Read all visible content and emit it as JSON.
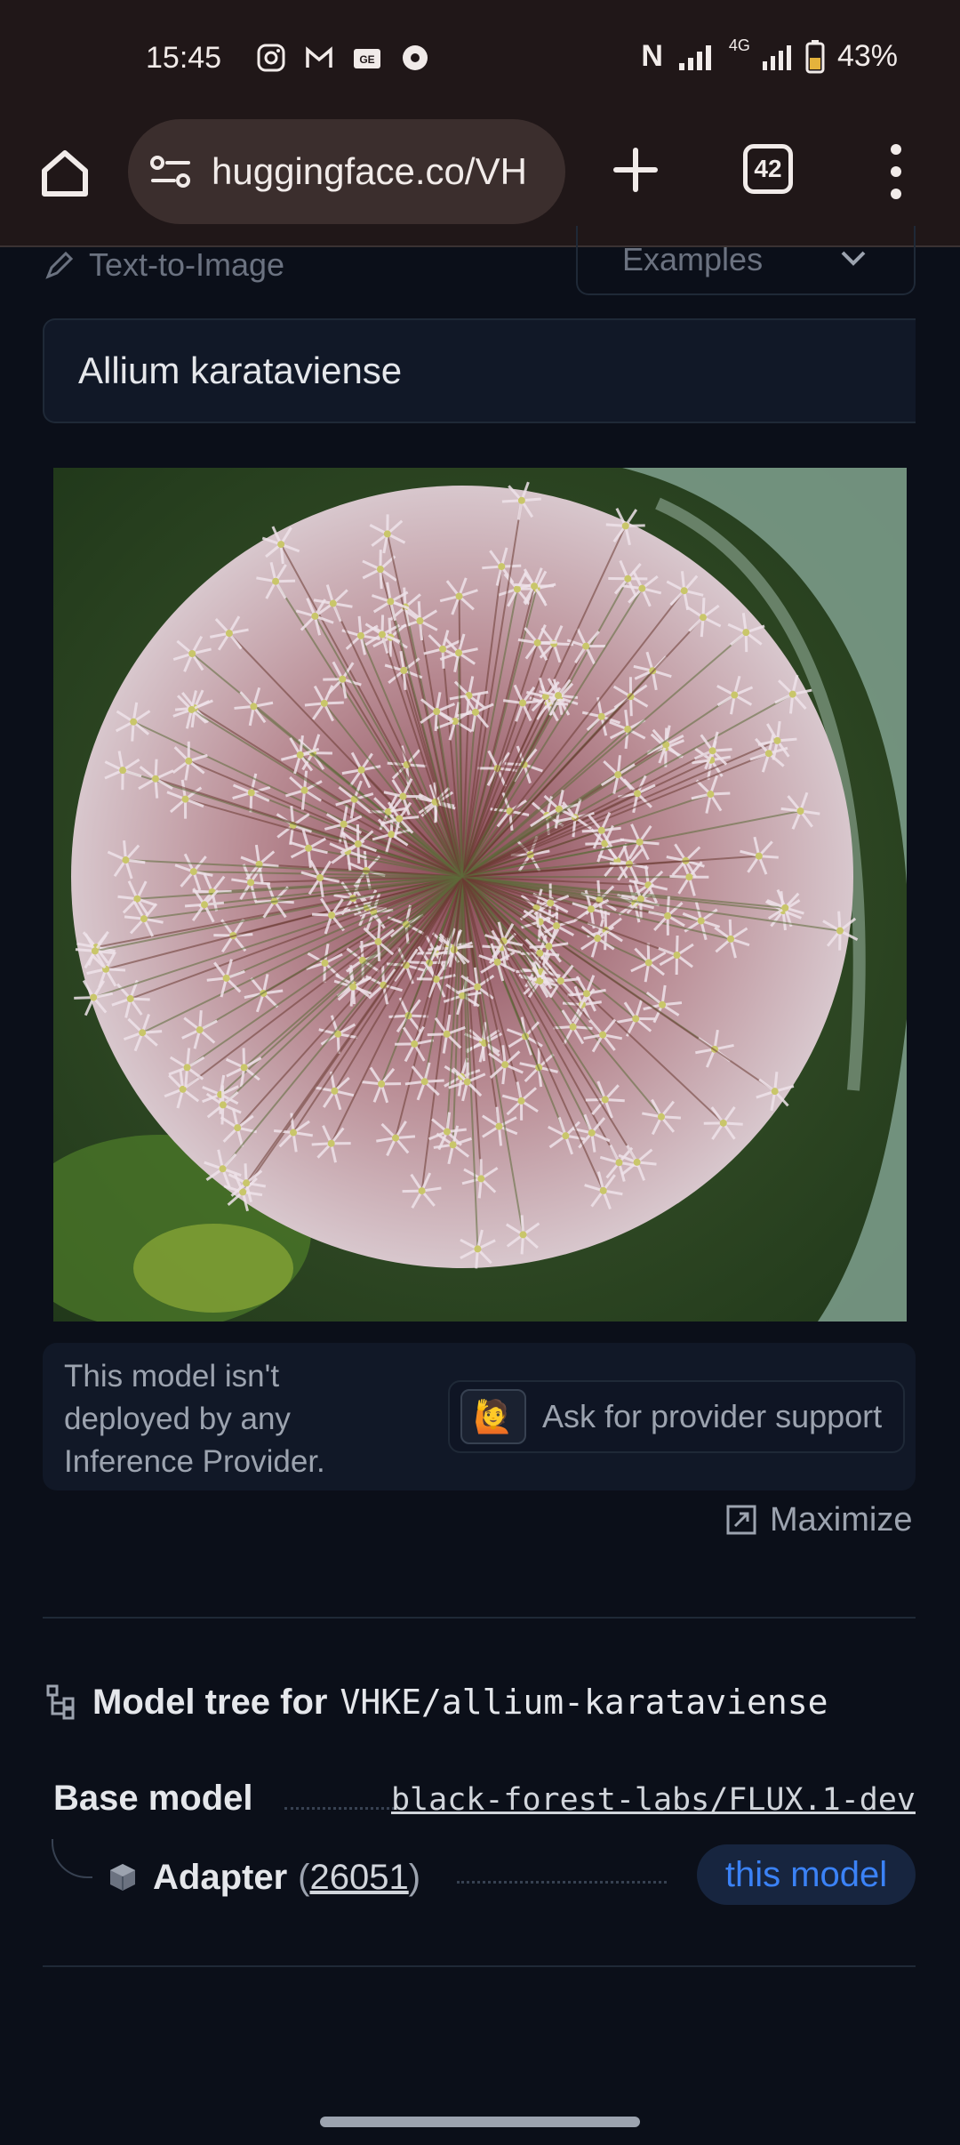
{
  "status_bar": {
    "time": "15:45",
    "app_icons": [
      "instagram-icon",
      "gmail-icon",
      "news-icon",
      "chrome-icon"
    ],
    "nfc": "N",
    "network": "4G",
    "battery": "43%"
  },
  "browser": {
    "url": "huggingface.co/VH",
    "tab_count": "42"
  },
  "page": {
    "task_label": "Text-to-Image",
    "examples_label": "Examples",
    "prompt_value": "Allium karataviense",
    "notice_text": "This model isn't deployed by any Inference Provider.",
    "provider_button_emoji": "🙋",
    "provider_button_label": "Ask for provider support",
    "maximize_label": "Maximize",
    "model_tree": {
      "title": "Model tree for",
      "repo": "VHKE/allium-karataviense",
      "base_model_label": "Base model",
      "base_model_value": "black-forest-labs/FLUX.1-dev",
      "adapter_label": "Adapter",
      "adapter_count_open": "(",
      "adapter_count": "26051",
      "adapter_count_close": ")",
      "this_model_label": "this model"
    }
  }
}
